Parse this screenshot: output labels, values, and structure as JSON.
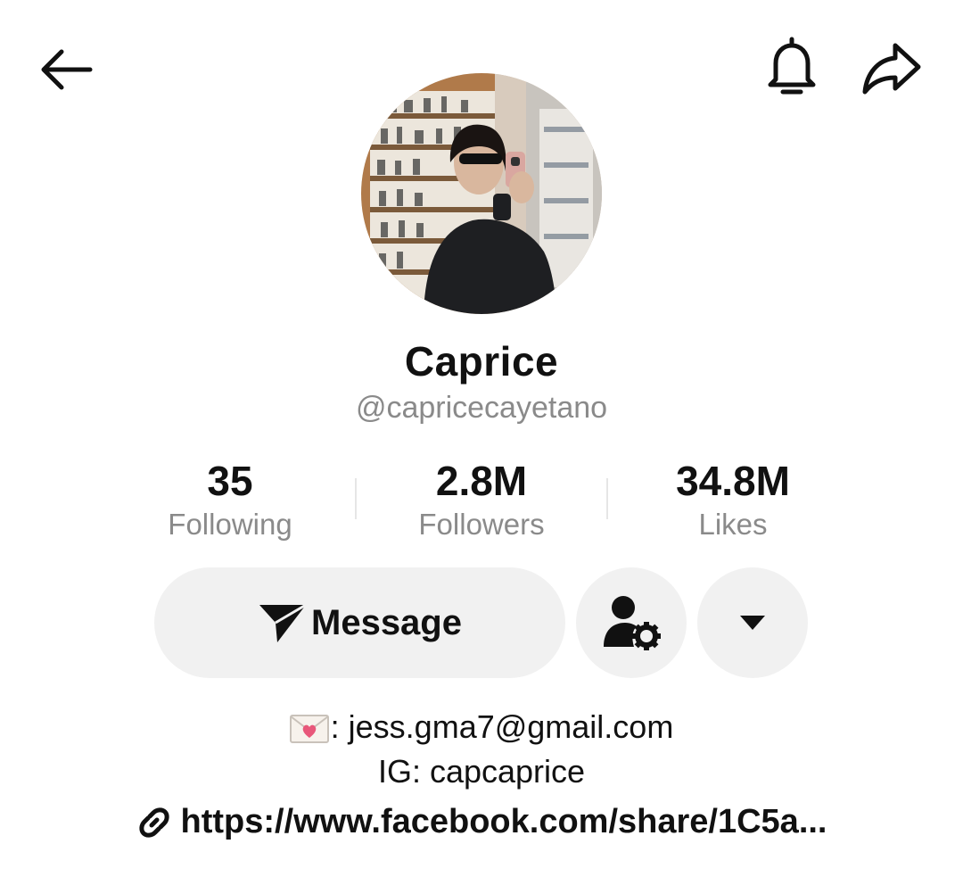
{
  "top_bar": {
    "back_icon": "arrow-left-icon",
    "bell_icon": "bell-icon",
    "share_icon": "share-arrow-icon"
  },
  "profile": {
    "display_name": "Caprice",
    "username": "@capricecayetano"
  },
  "stats": {
    "following": {
      "value": "35",
      "label": "Following"
    },
    "followers": {
      "value": "2.8M",
      "label": "Followers"
    },
    "likes": {
      "value": "34.8M",
      "label": "Likes"
    }
  },
  "actions": {
    "message_label": "Message",
    "message_icon": "send-icon",
    "settings_icon": "user-settings-icon",
    "more_icon": "caret-down-icon"
  },
  "bio": {
    "email_line": ": jess.gma7@gmail.com",
    "email_emoji": "love-letter-icon",
    "ig_line": "IG: capcaprice",
    "link_text": "https://www.facebook.com/share/1C5a..."
  },
  "colors": {
    "text": "#111111",
    "muted": "#8a8a8a",
    "button_bg": "#f1f1f1",
    "divider": "#e6e6e6"
  }
}
